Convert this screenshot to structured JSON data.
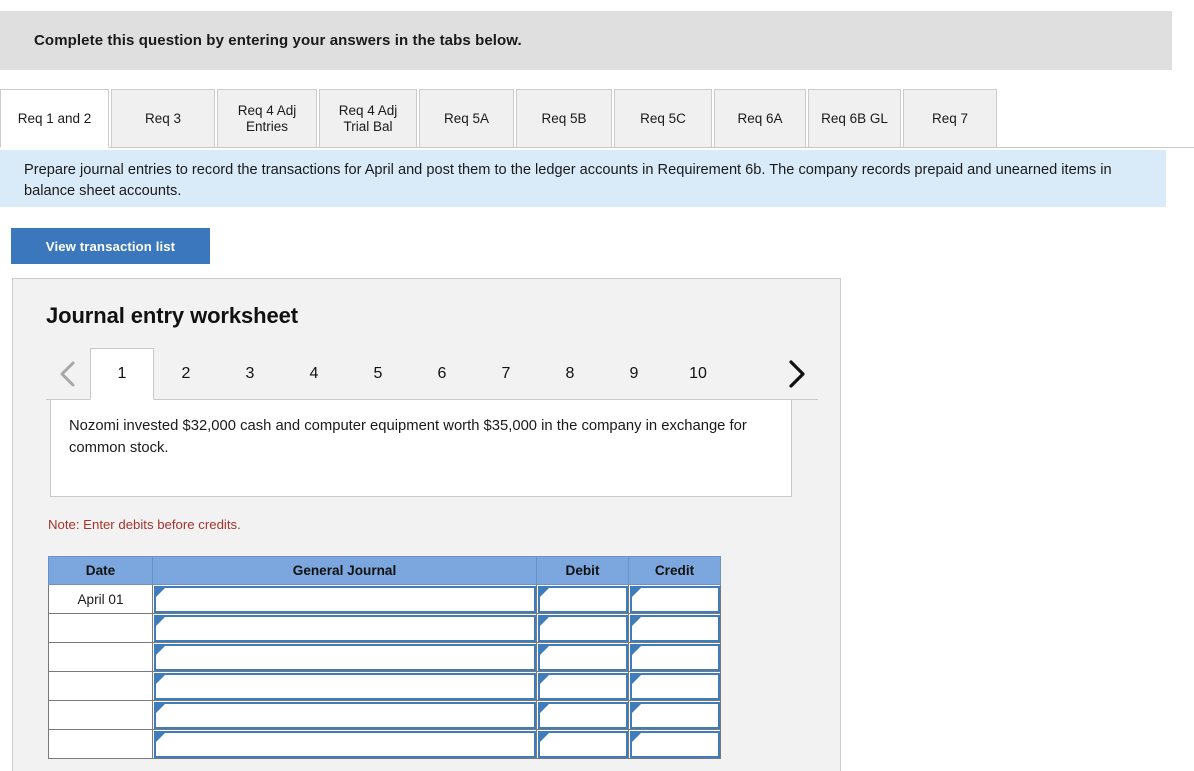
{
  "banner": {
    "text": "Complete this question by entering your answers in the tabs below."
  },
  "req_tabs": [
    {
      "label": "Req 1 and 2",
      "active": true
    },
    {
      "label": "Req 3",
      "active": false
    },
    {
      "label": "Req 4 Adj Entries",
      "active": false
    },
    {
      "label": "Req 4 Adj Trial Bal",
      "active": false
    },
    {
      "label": "Req 5A",
      "active": false
    },
    {
      "label": "Req 5B",
      "active": false
    },
    {
      "label": "Req 5C",
      "active": false
    },
    {
      "label": "Req 6A",
      "active": false
    },
    {
      "label": "Req 6B GL",
      "active": false
    },
    {
      "label": "Req 7",
      "active": false
    }
  ],
  "instructions": {
    "text": "Prepare journal entries to record the transactions for April and post them to the ledger accounts in Requirement 6b. The company records prepaid and unearned items in balance sheet accounts."
  },
  "toolbar": {
    "view_transaction_list_label": "View transaction list"
  },
  "worksheet": {
    "title": "Journal entry worksheet",
    "prev_label": "‹",
    "next_label": "›",
    "pages": [
      "1",
      "2",
      "3",
      "4",
      "5",
      "6",
      "7",
      "8",
      "9",
      "10"
    ],
    "active_page": "1",
    "transaction_text": "Nozomi invested $32,000 cash and computer equipment worth $35,000 in the company in exchange for common stock.",
    "note": "Note: Enter debits before credits."
  },
  "journal_table": {
    "columns": [
      "Date",
      "General Journal",
      "Debit",
      "Credit"
    ],
    "rows": [
      {
        "date": "April 01",
        "general_journal": "",
        "debit": "",
        "credit": ""
      },
      {
        "date": "",
        "general_journal": "",
        "debit": "",
        "credit": ""
      },
      {
        "date": "",
        "general_journal": "",
        "debit": "",
        "credit": ""
      },
      {
        "date": "",
        "general_journal": "",
        "debit": "",
        "credit": ""
      },
      {
        "date": "",
        "general_journal": "",
        "debit": "",
        "credit": ""
      },
      {
        "date": "",
        "general_journal": "",
        "debit": "",
        "credit": ""
      }
    ]
  },
  "colors": {
    "banner_gray": "#dfdfdf",
    "instruction_blue": "#d9eaf8",
    "button_blue": "#3b77bc",
    "table_header_blue": "#7ba7de",
    "input_border_blue": "#3e7cbb",
    "note_red": "#a6342e",
    "card_gray": "#f2f2f2"
  }
}
